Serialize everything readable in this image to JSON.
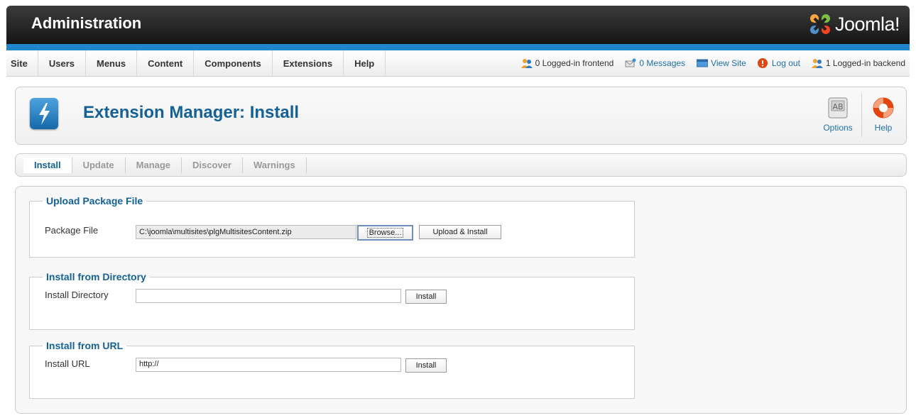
{
  "header": {
    "title": "Administration",
    "logo_text": "Joomla!"
  },
  "menu": {
    "items": [
      "Site",
      "Users",
      "Menus",
      "Content",
      "Components",
      "Extensions",
      "Help"
    ]
  },
  "status": {
    "frontend": "0 Logged-in frontend",
    "messages": "0 Messages",
    "view_site": "View Site",
    "logout": "Log out",
    "backend": "1 Logged-in backend"
  },
  "toolbar": {
    "title": "Extension Manager: Install",
    "options_label": "Options",
    "help_label": "Help"
  },
  "submenu": {
    "items": [
      "Install",
      "Update",
      "Manage",
      "Discover",
      "Warnings"
    ],
    "active": "Install"
  },
  "upload": {
    "legend": "Upload Package File",
    "label": "Package File",
    "file_value": "C:\\joomla\\multisites\\plgMultisitesContent.zip",
    "browse_label": "Browse...",
    "submit_label": "Upload & Install"
  },
  "directory": {
    "legend": "Install from Directory",
    "label": "Install Directory",
    "value": "",
    "submit_label": "Install"
  },
  "url": {
    "legend": "Install from URL",
    "label": "Install URL",
    "value": "http://",
    "submit_label": "Install"
  },
  "colors": {
    "accent": "#146295",
    "strip": "#1f84c8",
    "header": "#1e1e1e"
  }
}
